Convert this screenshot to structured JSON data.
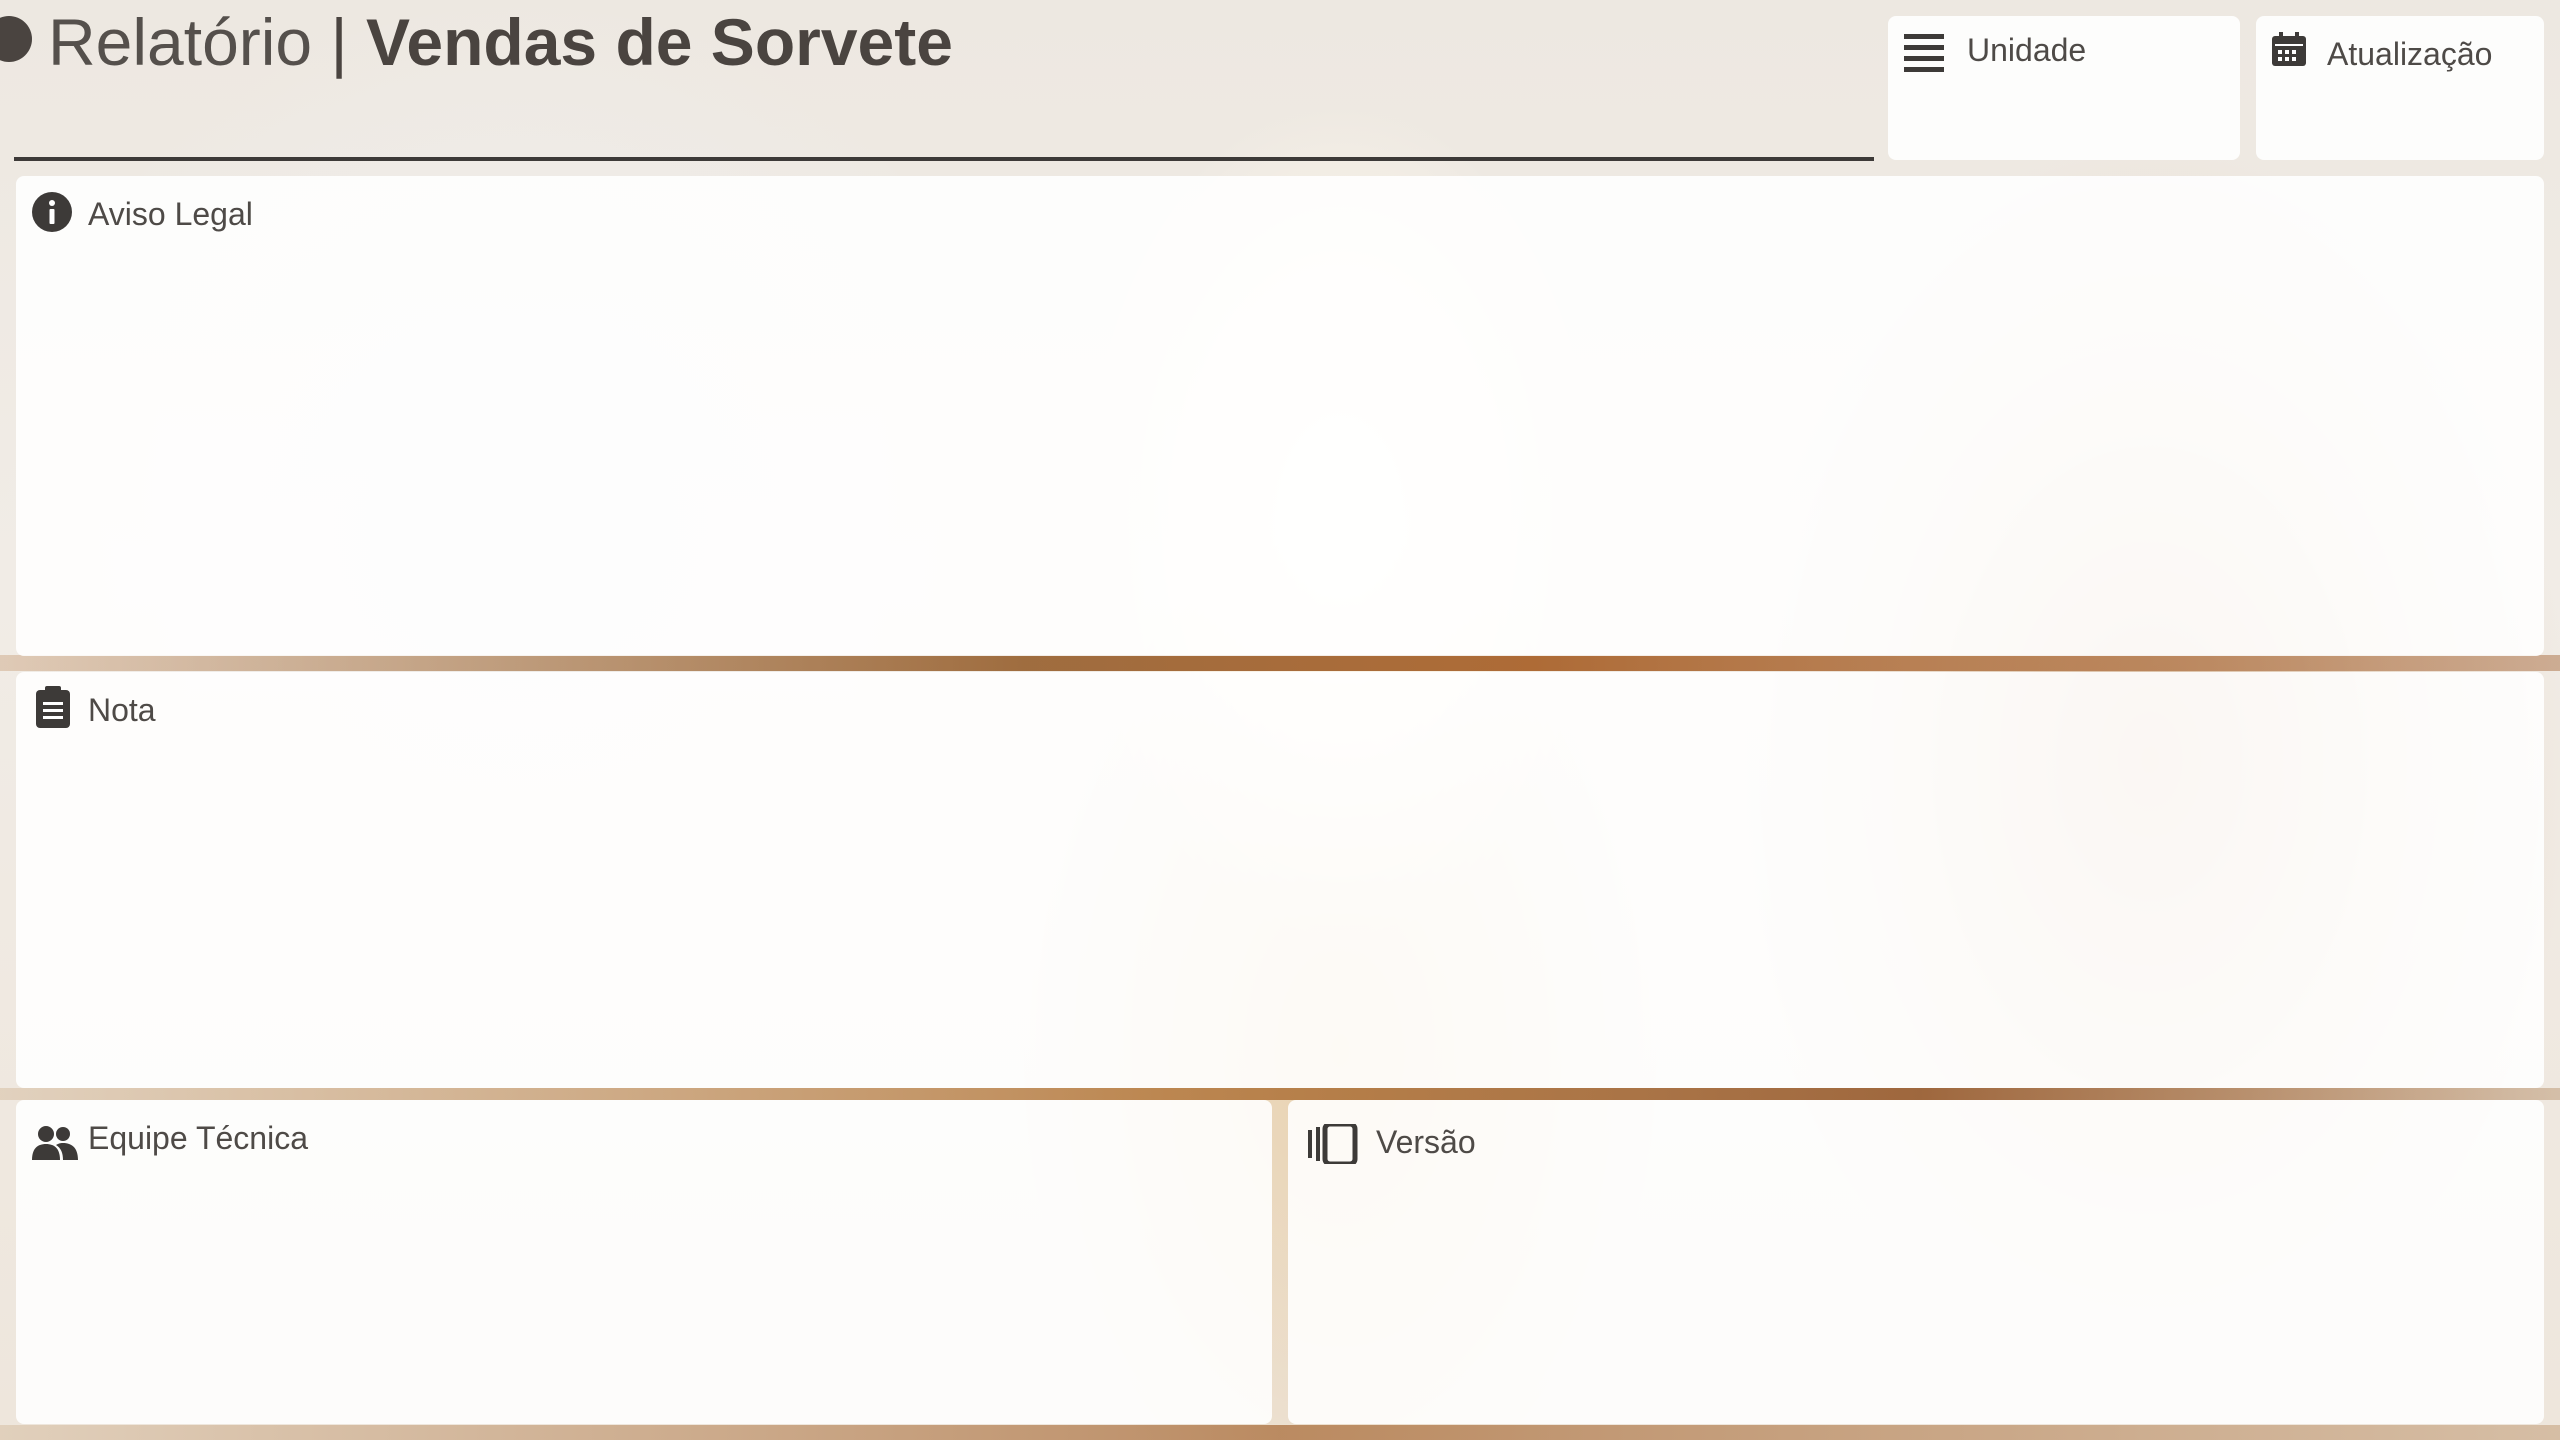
{
  "header": {
    "title_light": "Relatório",
    "title_separator": "|",
    "title_bold": "Vendas de Sorvete"
  },
  "filters": {
    "unidade": {
      "label": "Unidade",
      "icon": "list-lines-icon"
    },
    "atualizacao": {
      "label": "Atualização",
      "icon": "calendar-icon"
    }
  },
  "panels": {
    "aviso_legal": {
      "label": "Aviso Legal",
      "icon": "info-icon"
    },
    "nota": {
      "label": "Nota",
      "icon": "clipboard-icon"
    },
    "equipe_tecnica": {
      "label": "Equipe Técnica",
      "icon": "people-icon"
    },
    "versao": {
      "label": "Versão",
      "icon": "carousel-icon"
    }
  },
  "colors": {
    "text": "#4a4440",
    "card": "#ffffff",
    "rule": "#3d3a38"
  }
}
